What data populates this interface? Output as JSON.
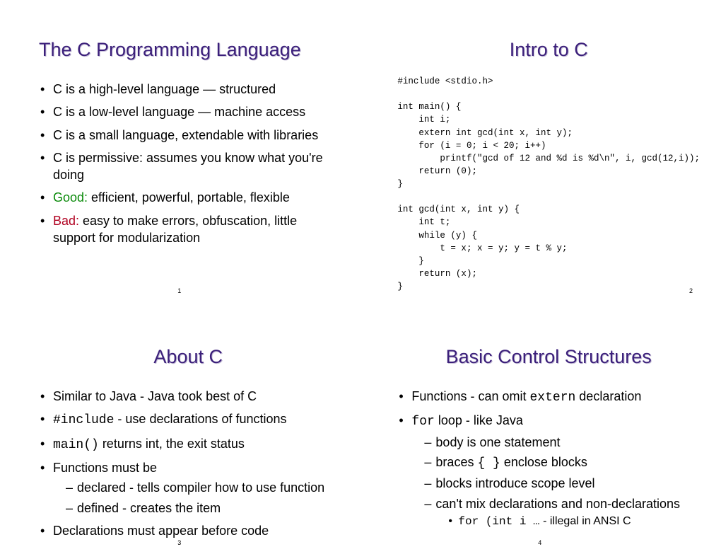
{
  "slides": {
    "s1": {
      "title": "The C Programming Language",
      "pageno": "1",
      "bullets": [
        "C is a high-level language — structured",
        "C is a low-level language — machine access",
        "C is a small language, extendable with libraries",
        "C is permissive: assumes you know what you're doing"
      ],
      "good_label": "Good:",
      "good_text": " efficient, powerful, portable, flexible",
      "bad_label": "Bad:",
      "bad_text": " easy to make errors, obfuscation, little support for modularization"
    },
    "s2": {
      "title": "Intro to C",
      "pageno": "2",
      "code": "#include <stdio.h>\n\nint main() {\n    int i;\n    extern int gcd(int x, int y);\n    for (i = 0; i < 20; i++)\n        printf(\"gcd of 12 and %d is %d\\n\", i, gcd(12,i));\n    return (0);\n}\n\nint gcd(int x, int y) {\n    int t;\n    while (y) {\n        t = x; x = y; y = t % y;\n    }\n    return (x);\n}"
    },
    "s3": {
      "title": "About C",
      "pageno": "3",
      "b1": "Similar to Java - Java took best of C",
      "b2_code": "#include",
      "b2_rest": " - use declarations of functions",
      "b3_code": "main()",
      "b3_rest": " returns int, the exit status",
      "b4": "Functions must be",
      "b4s1": "declared - tells compiler how to use function",
      "b4s2": "defined - creates the item",
      "b5": "Declarations must appear before code"
    },
    "s4": {
      "title": "Basic Control Structures",
      "pageno": "4",
      "b1_a": "Functions - can omit ",
      "b1_code": "extern",
      "b1_b": " declaration",
      "b2_code": "for",
      "b2_rest": " loop - like Java",
      "b2s1": "body is one statement",
      "b2s2_a": "braces ",
      "b2s2_code": "{ }",
      "b2s2_b": " enclose blocks",
      "b2s3": "blocks introduce scope level",
      "b2s4": "can't mix declarations and non-declarations",
      "b2s4s_code": "for (int i …",
      "b2s4s_rest": "  - illegal in ANSI C"
    }
  }
}
